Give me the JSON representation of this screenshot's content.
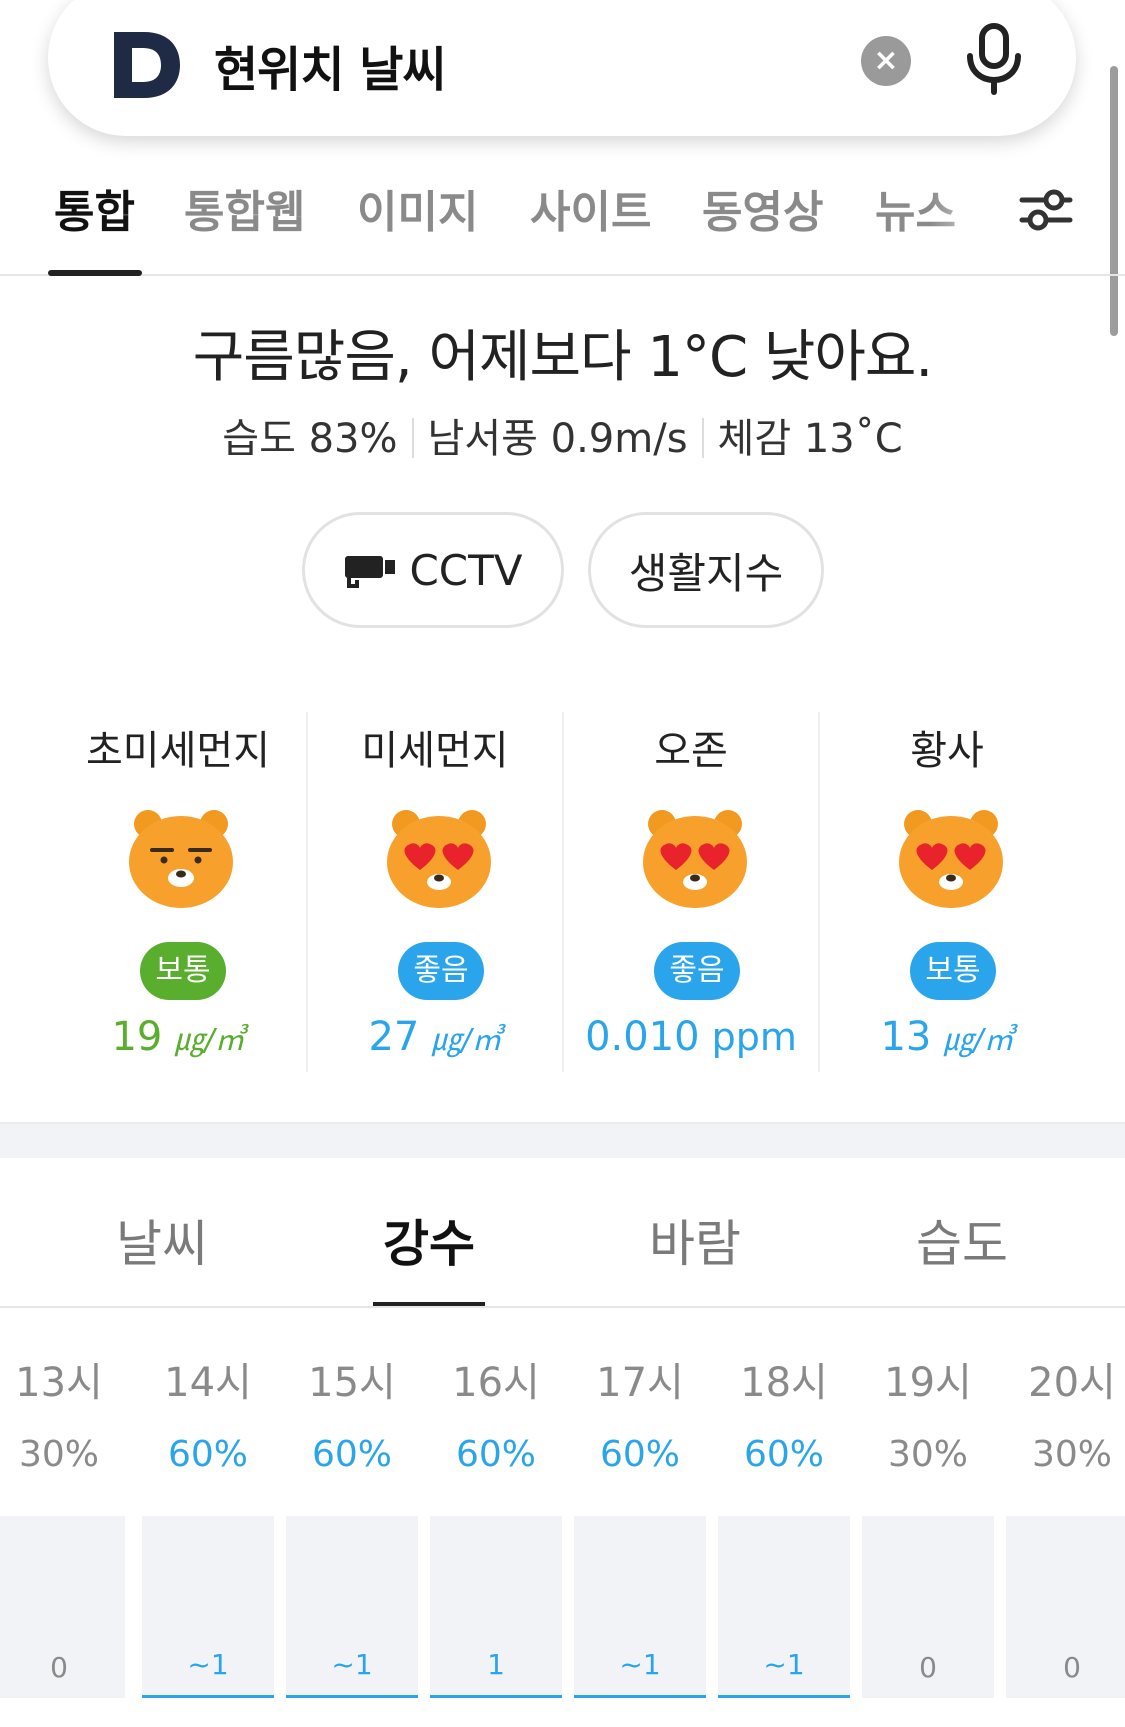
{
  "search": {
    "query": "현위치 날씨",
    "clear_icon": "×"
  },
  "nav": {
    "tabs": [
      {
        "label": "통합",
        "active": true
      },
      {
        "label": "통합웹",
        "active": false
      },
      {
        "label": "이미지",
        "active": false
      },
      {
        "label": "사이트",
        "active": false
      },
      {
        "label": "동영상",
        "active": false
      },
      {
        "label": "뉴스",
        "active": false
      }
    ]
  },
  "summary": {
    "headline": "구름많음, 어제보다 1°C 낮아요.",
    "humidity": "습도 83%",
    "wind": "남서풍 0.9m/s",
    "feels_like": "체감 13˚C"
  },
  "buttons": {
    "cctv": "CCTV",
    "life_index": "생활지수"
  },
  "air_quality": [
    {
      "title": "초미세먼지",
      "face": "neutral",
      "grade": "보통",
      "badge_color": "#5aae2e",
      "value": "19",
      "unit": "㎍/㎥",
      "value_color": "#5aae2e"
    },
    {
      "title": "미세먼지",
      "face": "hearts",
      "grade": "좋음",
      "badge_color": "#2aa5ec",
      "value": "27",
      "unit": "㎍/㎥",
      "value_color": "#2aa5ec"
    },
    {
      "title": "오존",
      "face": "hearts",
      "grade": "좋음",
      "badge_color": "#2aa5ec",
      "value": "0.010",
      "unit": "ppm",
      "value_color": "#2aa5ec"
    },
    {
      "title": "황사",
      "face": "hearts",
      "grade": "보통",
      "badge_color": "#2aa5ec",
      "value": "13",
      "unit": "㎍/㎥",
      "value_color": "#2aa5ec"
    }
  ],
  "weather_tabs": [
    {
      "label": "날씨",
      "active": false
    },
    {
      "label": "강수",
      "active": true
    },
    {
      "label": "바람",
      "active": false
    },
    {
      "label": "습도",
      "active": false
    }
  ],
  "hourly": [
    {
      "hour": "13시",
      "prob": "30%",
      "amount": "0",
      "rain": false
    },
    {
      "hour": "14시",
      "prob": "60%",
      "amount": "~1",
      "rain": true
    },
    {
      "hour": "15시",
      "prob": "60%",
      "amount": "~1",
      "rain": true
    },
    {
      "hour": "16시",
      "prob": "60%",
      "amount": "1",
      "rain": true
    },
    {
      "hour": "17시",
      "prob": "60%",
      "amount": "~1",
      "rain": true
    },
    {
      "hour": "18시",
      "prob": "60%",
      "amount": "~1",
      "rain": true
    },
    {
      "hour": "19시",
      "prob": "30%",
      "amount": "0",
      "rain": false
    },
    {
      "hour": "20시",
      "prob": "30%",
      "amount": "0",
      "rain": false
    }
  ],
  "colors": {
    "accent_blue": "#2aa5ec",
    "accent_green": "#5aae2e",
    "logo_navy": "#1f2a44"
  }
}
